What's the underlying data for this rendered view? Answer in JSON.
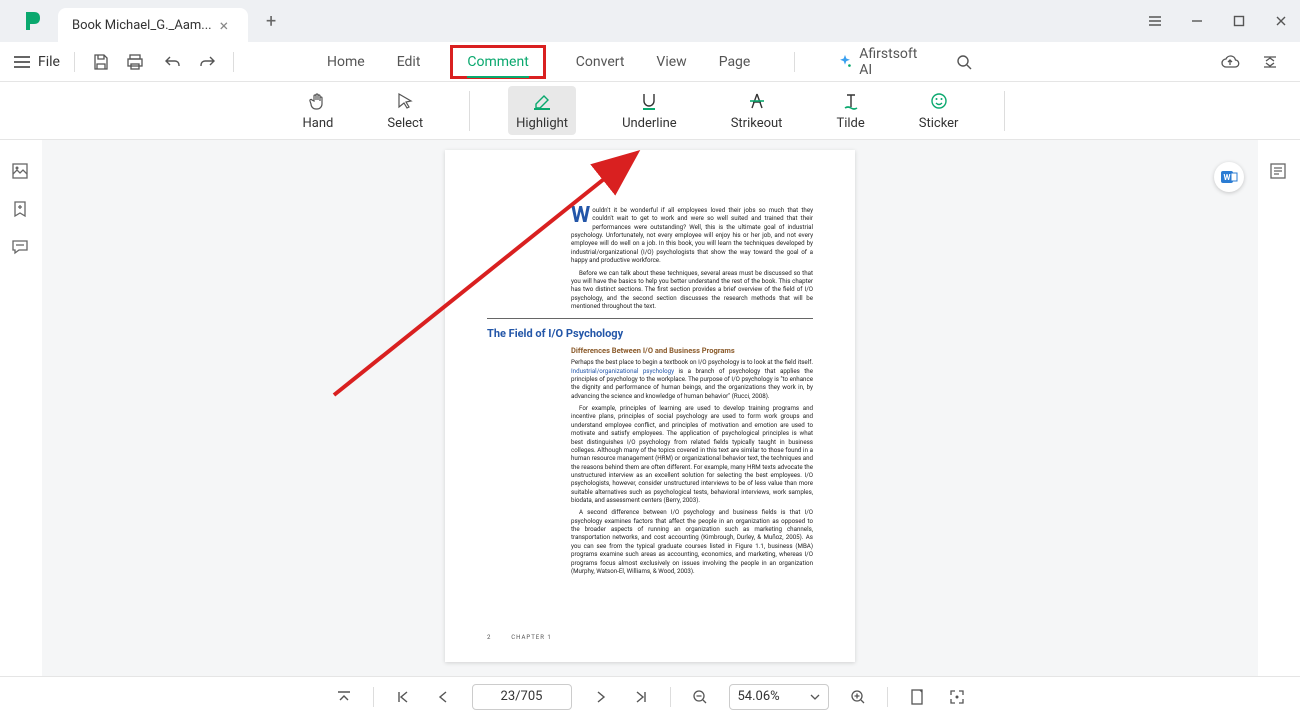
{
  "titlebar": {
    "tab_title": "Book Michael_G._Aam...",
    "tab_close": "×",
    "tab_add": "+"
  },
  "menubar": {
    "file": "File",
    "items": [
      "Home",
      "Edit",
      "Comment",
      "Convert",
      "View",
      "Page"
    ],
    "active_index": 2,
    "ai_label": "Afirstsoft AI"
  },
  "toolbar": {
    "tools": [
      {
        "name": "hand",
        "label": "Hand"
      },
      {
        "name": "select",
        "label": "Select"
      },
      {
        "name": "highlight",
        "label": "Highlight"
      },
      {
        "name": "underline",
        "label": "Underline"
      },
      {
        "name": "strikeout",
        "label": "Strikeout"
      },
      {
        "name": "tilde",
        "label": "Tilde"
      },
      {
        "name": "sticker",
        "label": "Sticker"
      }
    ],
    "selected_index": 2
  },
  "document": {
    "intro_first": "W",
    "intro": "ouldn't it be wonderful if all employees loved their jobs so much that they couldn't wait to get to work and were so well suited and trained that their performances were outstanding? Well, this is the ultimate goal of industrial psychology. Unfortunately, not every employee will enjoy his or her job, and not every employee will do well on a job. In this book, you will learn the techniques developed by industrial/organizational (I/O) psychologists that show the way toward the goal of a happy and productive workforce.",
    "intro2": "Before we can talk about these techniques, several areas must be discussed so that you will have the basics to help you better understand the rest of the book. This chapter has two distinct sections. The first section provides a brief overview of the field of I/O psychology, and the second section discusses the research methods that will be mentioned throughout the text.",
    "h2": "The Field of I/O Psychology",
    "h3": "Differences Between I/O and Business Programs",
    "p1a": "Perhaps the best place to begin a textbook on I/O psychology is to look at the field itself. ",
    "p1link": "Industrial/organizational psychology",
    "p1b": " is a branch of psychology that applies the principles of psychology to the workplace. The purpose of I/O psychology is \"to enhance the dignity and performance of human beings, and the organizations they work in, by advancing the science and knowledge of human behavior\" (Rucci, 2008).",
    "p2": "For example, principles of learning are used to develop training programs and incentive plans, principles of social psychology are used to form work groups and understand employee conflict, and principles of motivation and emotion are used to motivate and satisfy employees. The application of psychological principles is what best distinguishes I/O psychology from related fields typically taught in business colleges. Although many of the topics covered in this text are similar to those found in a human resource management (HRM) or organizational behavior text, the techniques and the reasons behind them are often different. For example, many HRM texts advocate the unstructured interview as an excellent solution for selecting the best employees. I/O psychologists, however, consider unstructured interviews to be of less value than more suitable alternatives such as psychological tests, behavioral interviews, work samples, biodata, and assessment centers (Berry, 2003).",
    "p3": "A second difference between I/O psychology and business fields is that I/O psychology examines factors that affect the people in an organization as opposed to the broader aspects of running an organization such as marketing channels, transportation networks, and cost accounting (Kimbrough, Durley, & Muñoz, 2005). As you can see from the typical graduate courses listed in Figure 1.1, business (MBA) programs examine such areas as accounting, economics, and marketing, whereas I/O programs focus almost exclusively on issues involving the people in an organization (Murphy, Watson-El, Williams, & Wood, 2003).",
    "footer_pagenum": "2",
    "footer_chapter": "CHAPTER 1"
  },
  "statusbar": {
    "page": "23/705",
    "zoom": "54.06%"
  },
  "colors": {
    "accent": "#0aa86e",
    "annotation": "#d92020"
  }
}
